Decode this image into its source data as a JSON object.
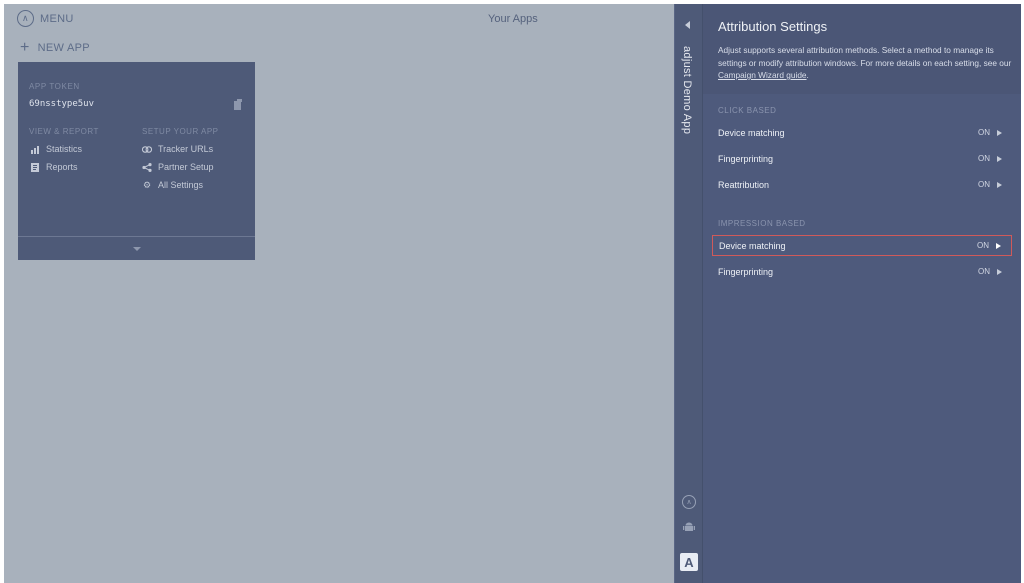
{
  "menu": {
    "label": "MENU",
    "icon": "adjust-logo-icon"
  },
  "page_title": "Your Apps",
  "new_app": {
    "label": "NEW APP",
    "icon": "plus-icon"
  },
  "app_card": {
    "token_label": "APP TOKEN",
    "token": "69nsstype5uv",
    "view_report_label": "VIEW & REPORT",
    "setup_label": "SETUP YOUR APP",
    "view_report_items": [
      {
        "label": "Statistics",
        "icon": "bar-chart-icon"
      },
      {
        "label": "Reports",
        "icon": "document-icon"
      }
    ],
    "setup_items": [
      {
        "label": "Tracker URLs",
        "icon": "link-icon"
      },
      {
        "label": "Partner Setup",
        "icon": "share-icon"
      },
      {
        "label": "All Settings",
        "icon": "gear-icon"
      }
    ]
  },
  "appbar": {
    "app_name": "adjust Demo App",
    "brand_letter": "A"
  },
  "panel": {
    "title": "Attribution Settings",
    "desc_before": "Adjust supports several attribution methods. Select a method to manage its settings or modify attribution windows. For more details on each setting, see our ",
    "desc_link": "Campaign Wizard guide",
    "desc_after": ".",
    "click_based_label": "CLICK BASED",
    "impression_based_label": "IMPRESSION BASED",
    "click_rows": [
      {
        "label": "Device matching",
        "state": "ON"
      },
      {
        "label": "Fingerprinting",
        "state": "ON"
      },
      {
        "label": "Reattribution",
        "state": "ON"
      }
    ],
    "impression_rows": [
      {
        "label": "Device matching",
        "state": "ON"
      },
      {
        "label": "Fingerprinting",
        "state": "ON"
      }
    ]
  },
  "colors": {
    "main_bg": "#a8b1bc",
    "card_bg": "#4e5a78",
    "panel_bg": "#4e5a7c",
    "highlight_border": "#d05a5a"
  }
}
